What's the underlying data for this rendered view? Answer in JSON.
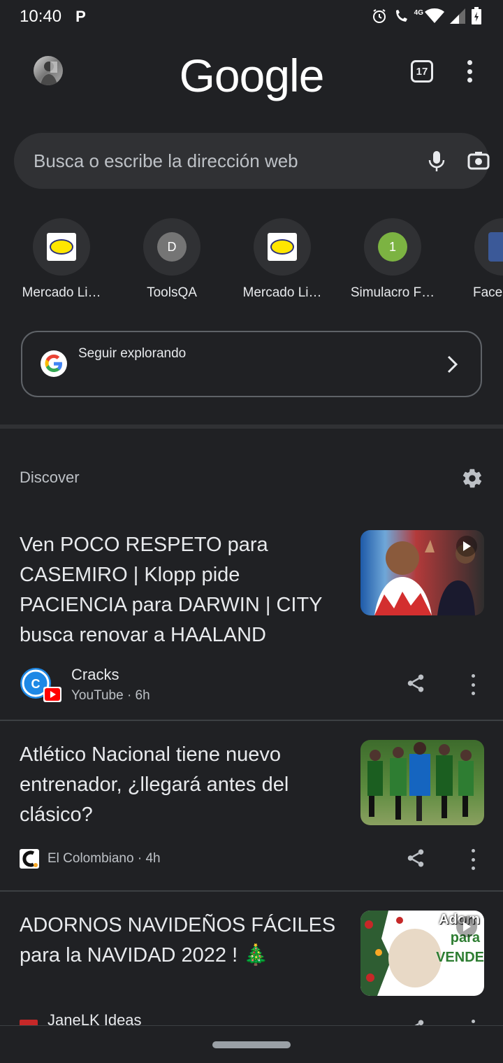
{
  "status_bar": {
    "time": "10:40",
    "notification_letter": "P",
    "network": "4G"
  },
  "top_bar": {
    "logo": "Google",
    "tab_count": "17"
  },
  "search": {
    "placeholder": "Busca o escribe la dirección web"
  },
  "shortcuts": [
    {
      "label": "Mercado Li…",
      "icon": "mercado-libre-icon"
    },
    {
      "label": "ToolsQA",
      "letter": "D",
      "color": "#757575"
    },
    {
      "label": "Mercado Li…",
      "icon": "mercado-libre-icon"
    },
    {
      "label": "Simulacro F…",
      "letter": "1",
      "color": "#7cb342"
    },
    {
      "label": "Face",
      "icon": "facebook-icon"
    }
  ],
  "explore": {
    "label": "Seguir explorando"
  },
  "discover": {
    "title": "Discover",
    "articles": [
      {
        "title": "Ven POCO RESPETO para CASEMIRO | Klopp pide PACIENCIA para DARWIN | CITY busca renovar a HAALAND",
        "source": "Cracks",
        "meta": "YouTube · 6h"
      },
      {
        "title": "Atlético Nacional tiene nuevo entrenador, ¿llegará antes del clásico?",
        "source": "El Colombiano · 4h"
      },
      {
        "title": "ADORNOS NAVIDEÑOS FÁCILES para la NAVIDAD 2022 ! 🎄",
        "source": "JaneLK Ideas",
        "thumb_text_1": "Adorn",
        "thumb_text_2": "para",
        "thumb_text_3": "VENDE"
      }
    ]
  },
  "colors": {
    "background": "#202124",
    "surface": "#303134",
    "text": "#e8eaed"
  }
}
